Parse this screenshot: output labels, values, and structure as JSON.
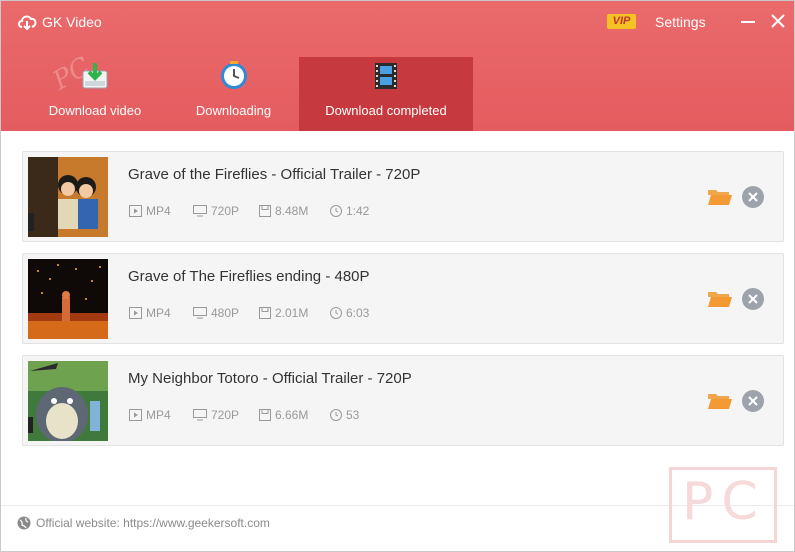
{
  "app": {
    "title": "GK Video",
    "vip_label": "VIP",
    "settings_label": "Settings"
  },
  "tabs": [
    {
      "label": "Download video",
      "icon": "download-box-icon",
      "active": false
    },
    {
      "label": "Downloading",
      "icon": "clock-icon",
      "active": false
    },
    {
      "label": "Download completed",
      "icon": "film-icon",
      "active": true
    }
  ],
  "items": [
    {
      "title": "Grave of the Fireflies - Official Trailer - 720P",
      "format": "MP4",
      "resolution": "720P",
      "size": "8.48M",
      "duration": "1:42"
    },
    {
      "title": "Grave of The Fireflies ending - 480P",
      "format": "MP4",
      "resolution": "480P",
      "size": "2.01M",
      "duration": "6:03"
    },
    {
      "title": "My Neighbor Totoro - Official Trailer - 720P",
      "format": "MP4",
      "resolution": "720P",
      "size": "6.66M",
      "duration": "53"
    }
  ],
  "footer": {
    "text": "Official website: https://www.geekersoft.com"
  },
  "colors": {
    "header": "#e45c5f",
    "active_tab": "#c63a3f",
    "folder": "#f39a35",
    "remove": "#9ea3ab"
  }
}
